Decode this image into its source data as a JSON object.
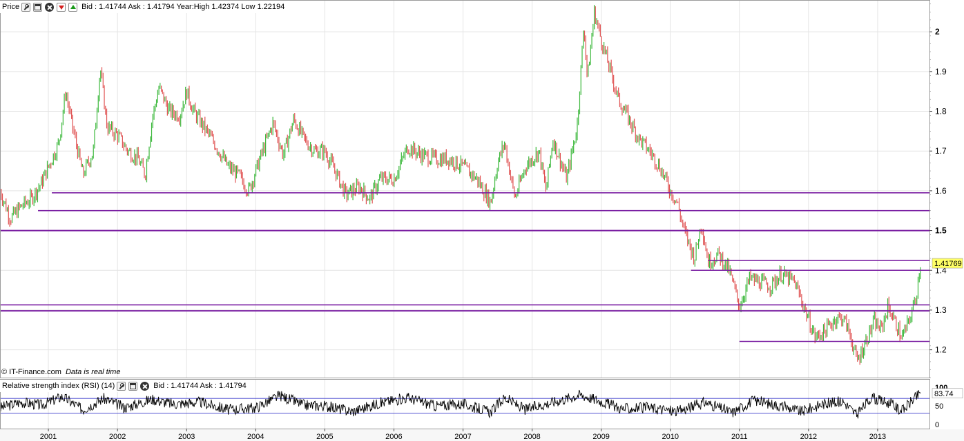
{
  "price_panel": {
    "title": "Price",
    "info": "Bid : 1.41744 Ask : 1.41794 Year:High 1.42374 Low 1.22194",
    "last_price_label": "1.41769"
  },
  "rsi_panel": {
    "title": "Relative strength index (RSI) (14)",
    "info": "Bid : 1.41744 Ask : 1.41794",
    "last_value_label": "83.74"
  },
  "credit": {
    "source": "© IT-Finance.com",
    "realtime": "Data is real time"
  },
  "colors": {
    "up_candle": "#3cb83c",
    "down_candle": "#e05252",
    "support_line": "#7a1fa2",
    "rsi_line": "#000000",
    "last_price_badge": "#ffff66"
  },
  "chart_data": [
    {
      "type": "line",
      "panel": "price",
      "x_axis": {
        "labels": [
          "2001",
          "2002",
          "2003",
          "2004",
          "2005",
          "2006",
          "2007",
          "2008",
          "2009",
          "2010",
          "2011",
          "2012",
          "2013"
        ],
        "range": [
          2000.3,
          2013.75
        ]
      },
      "y_axis": {
        "range": [
          1.13,
          2.08
        ],
        "ticks": [
          "1.2",
          "1.3",
          "1.4",
          "1.5",
          "1.6",
          "1.7",
          "1.8",
          "1.9",
          "2"
        ],
        "bold_ticks": [
          "1.5",
          "2"
        ]
      },
      "grid": true,
      "series": [
        {
          "points": [
            [
              2000.3,
              1.6
            ],
            [
              2000.45,
              1.53
            ],
            [
              2000.6,
              1.56
            ],
            [
              2000.75,
              1.58
            ],
            [
              2000.9,
              1.62
            ],
            [
              2001.0,
              1.66
            ],
            [
              2001.15,
              1.72
            ],
            [
              2001.25,
              1.85
            ],
            [
              2001.35,
              1.76
            ],
            [
              2001.5,
              1.64
            ],
            [
              2001.65,
              1.7
            ],
            [
              2001.75,
              1.91
            ],
            [
              2001.85,
              1.76
            ],
            [
              2002.0,
              1.74
            ],
            [
              2002.15,
              1.7
            ],
            [
              2002.3,
              1.68
            ],
            [
              2002.4,
              1.64
            ],
            [
              2002.5,
              1.78
            ],
            [
              2002.6,
              1.86
            ],
            [
              2002.75,
              1.8
            ],
            [
              2002.9,
              1.79
            ],
            [
              2003.0,
              1.85
            ],
            [
              2003.1,
              1.8
            ],
            [
              2003.25,
              1.76
            ],
            [
              2003.4,
              1.72
            ],
            [
              2003.6,
              1.66
            ],
            [
              2003.75,
              1.64
            ],
            [
              2003.9,
              1.6
            ],
            [
              2004.1,
              1.7
            ],
            [
              2004.25,
              1.77
            ],
            [
              2004.4,
              1.69
            ],
            [
              2004.55,
              1.78
            ],
            [
              2004.7,
              1.73
            ],
            [
              2004.85,
              1.7
            ],
            [
              2005.0,
              1.7
            ],
            [
              2005.15,
              1.65
            ],
            [
              2005.3,
              1.59
            ],
            [
              2005.5,
              1.61
            ],
            [
              2005.65,
              1.58
            ],
            [
              2005.8,
              1.63
            ],
            [
              2006.0,
              1.63
            ],
            [
              2006.2,
              1.71
            ],
            [
              2006.4,
              1.69
            ],
            [
              2006.6,
              1.68
            ],
            [
              2006.8,
              1.68
            ],
            [
              2007.0,
              1.66
            ],
            [
              2007.2,
              1.63
            ],
            [
              2007.4,
              1.57
            ],
            [
              2007.5,
              1.67
            ],
            [
              2007.6,
              1.72
            ],
            [
              2007.75,
              1.58
            ],
            [
              2007.9,
              1.66
            ],
            [
              2008.1,
              1.7
            ],
            [
              2008.2,
              1.6
            ],
            [
              2008.3,
              1.73
            ],
            [
              2008.5,
              1.63
            ],
            [
              2008.65,
              1.76
            ],
            [
              2008.75,
              2.02
            ],
            [
              2008.8,
              1.88
            ],
            [
              2008.9,
              2.05
            ],
            [
              2009.0,
              1.98
            ],
            [
              2009.1,
              1.92
            ],
            [
              2009.25,
              1.83
            ],
            [
              2009.4,
              1.78
            ],
            [
              2009.55,
              1.73
            ],
            [
              2009.7,
              1.7
            ],
            [
              2009.85,
              1.66
            ],
            [
              2010.0,
              1.6
            ],
            [
              2010.1,
              1.57
            ],
            [
              2010.2,
              1.5
            ],
            [
              2010.35,
              1.43
            ],
            [
              2010.45,
              1.52
            ],
            [
              2010.55,
              1.42
            ],
            [
              2010.7,
              1.44
            ],
            [
              2010.85,
              1.4
            ],
            [
              2011.0,
              1.31
            ],
            [
              2011.15,
              1.38
            ],
            [
              2011.3,
              1.37
            ],
            [
              2011.45,
              1.36
            ],
            [
              2011.6,
              1.39
            ],
            [
              2011.8,
              1.37
            ],
            [
              2011.95,
              1.3
            ],
            [
              2012.1,
              1.23
            ],
            [
              2012.25,
              1.25
            ],
            [
              2012.4,
              1.28
            ],
            [
              2012.5,
              1.28
            ],
            [
              2012.6,
              1.24
            ],
            [
              2012.7,
              1.17
            ],
            [
              2012.8,
              1.21
            ],
            [
              2012.95,
              1.27
            ],
            [
              2013.05,
              1.25
            ],
            [
              2013.15,
              1.31
            ],
            [
              2013.25,
              1.27
            ],
            [
              2013.35,
              1.23
            ],
            [
              2013.45,
              1.27
            ],
            [
              2013.55,
              1.33
            ],
            [
              2013.62,
              1.417
            ]
          ]
        }
      ],
      "horizontal_lines": [
        {
          "y": 1.595,
          "x_start": 2001.05,
          "x_end": 2013.75
        },
        {
          "y": 1.55,
          "x_start": 2000.85,
          "x_end": 2013.75
        },
        {
          "y": 1.5,
          "x_start": 2000.3,
          "x_end": 2013.75
        },
        {
          "y": 1.425,
          "x_start": 2010.55,
          "x_end": 2013.75
        },
        {
          "y": 1.4,
          "x_start": 2010.3,
          "x_end": 2013.75
        },
        {
          "y": 1.313,
          "x_start": 2000.3,
          "x_end": 2013.75
        },
        {
          "y": 1.298,
          "x_start": 2000.3,
          "x_end": 2013.75
        },
        {
          "y": 1.221,
          "x_start": 2011.0,
          "x_end": 2013.75
        }
      ],
      "last_value": 1.41769
    },
    {
      "type": "line",
      "panel": "rsi",
      "y_axis": {
        "range": [
          0,
          100
        ],
        "ticks": [
          "0",
          "50",
          "100"
        ],
        "levels": [
          30,
          70
        ]
      },
      "series": [
        {
          "points": [
            [
              2000.3,
              45
            ],
            [
              2000.6,
              60
            ],
            [
              2000.9,
              52
            ],
            [
              2001.2,
              75
            ],
            [
              2001.5,
              40
            ],
            [
              2001.8,
              70
            ],
            [
              2002.1,
              45
            ],
            [
              2002.5,
              68
            ],
            [
              2002.8,
              55
            ],
            [
              2003.2,
              60
            ],
            [
              2003.6,
              40
            ],
            [
              2004.0,
              45
            ],
            [
              2004.35,
              78
            ],
            [
              2004.7,
              52
            ],
            [
              2005.0,
              50
            ],
            [
              2005.4,
              35
            ],
            [
              2005.8,
              58
            ],
            [
              2006.2,
              72
            ],
            [
              2006.6,
              50
            ],
            [
              2007.0,
              55
            ],
            [
              2007.4,
              33
            ],
            [
              2007.6,
              72
            ],
            [
              2007.9,
              40
            ],
            [
              2008.3,
              60
            ],
            [
              2008.7,
              80
            ],
            [
              2009.0,
              62
            ],
            [
              2009.3,
              42
            ],
            [
              2009.7,
              45
            ],
            [
              2010.1,
              35
            ],
            [
              2010.5,
              60
            ],
            [
              2010.9,
              32
            ],
            [
              2011.2,
              65
            ],
            [
              2011.6,
              50
            ],
            [
              2011.9,
              35
            ],
            [
              2012.2,
              55
            ],
            [
              2012.5,
              62
            ],
            [
              2012.7,
              25
            ],
            [
              2012.9,
              72
            ],
            [
              2013.2,
              55
            ],
            [
              2013.35,
              35
            ],
            [
              2013.5,
              65
            ],
            [
              2013.62,
              83.74
            ]
          ]
        }
      ],
      "last_value": 83.74
    }
  ]
}
